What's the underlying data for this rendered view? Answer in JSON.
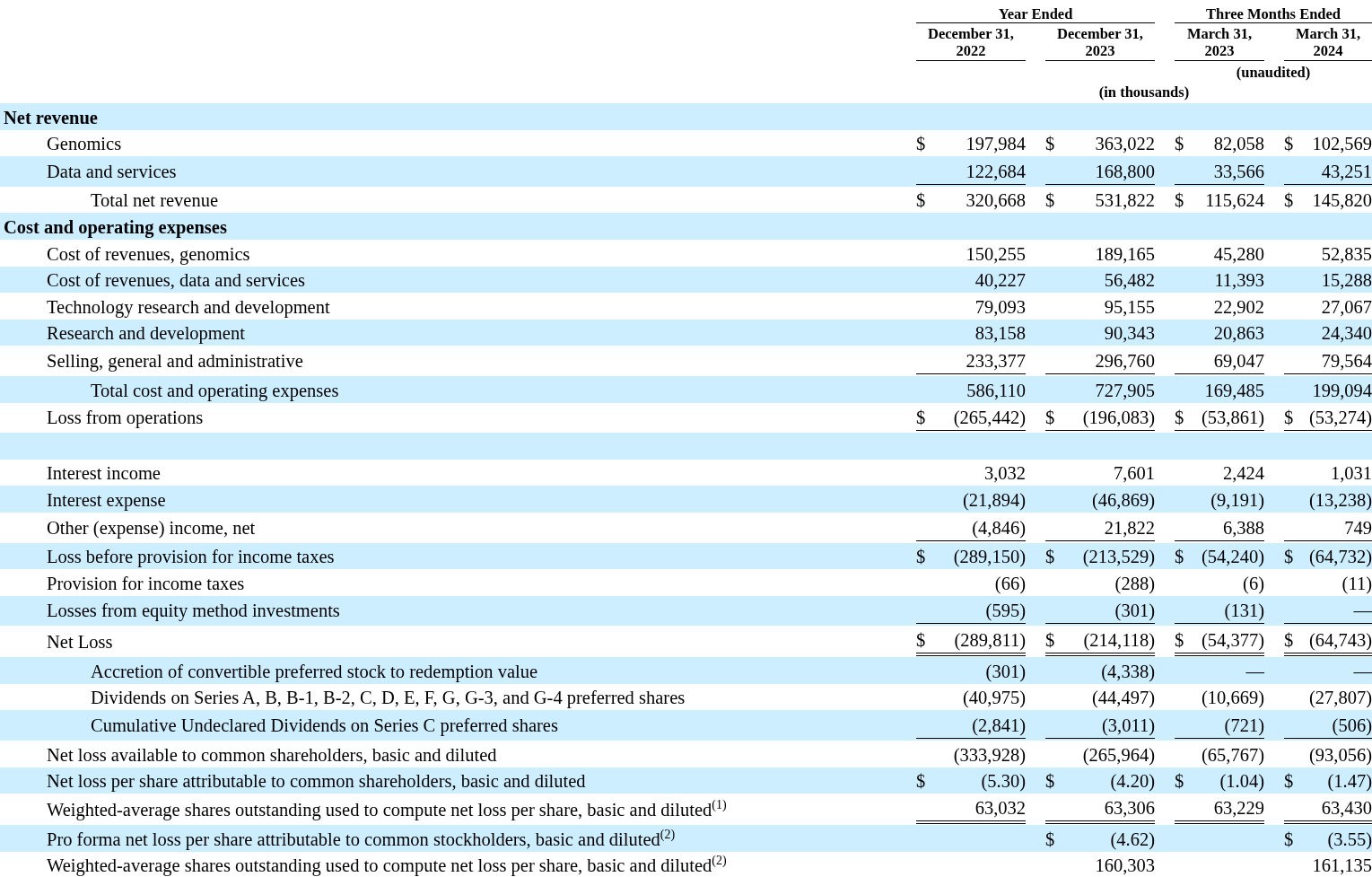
{
  "header": {
    "groups": [
      {
        "label": "Year Ended"
      },
      {
        "label": "Three Months Ended"
      }
    ],
    "columns": [
      "December 31, 2022",
      "December 31, 2023",
      "March 31, 2023",
      "March 31, 2024"
    ],
    "unaudited": "(unaudited)",
    "units": "(in thousands)"
  },
  "rows": [
    {
      "kind": "heading",
      "label": "Net revenue"
    },
    {
      "kind": "line",
      "label": "Genomics",
      "cells": [
        {
          "dollar": "$",
          "value": "197,984"
        },
        {
          "dollar": "$",
          "value": "363,022"
        },
        {
          "dollar": "$",
          "value": "82,058"
        },
        {
          "dollar": "$",
          "value": "102,569"
        }
      ]
    },
    {
      "kind": "line",
      "label": "Data and services",
      "underline": true,
      "cells": [
        {
          "value": "122,684"
        },
        {
          "value": "168,800"
        },
        {
          "value": "33,566"
        },
        {
          "value": "43,251"
        }
      ]
    },
    {
      "kind": "total",
      "label": "Total net revenue",
      "cells": [
        {
          "dollar": "$",
          "value": "320,668"
        },
        {
          "dollar": "$",
          "value": "531,822"
        },
        {
          "dollar": "$",
          "value": "115,624"
        },
        {
          "dollar": "$",
          "value": "145,820"
        }
      ]
    },
    {
      "kind": "heading",
      "label": "Cost and operating expenses"
    },
    {
      "kind": "line",
      "label": "Cost of revenues, genomics",
      "cells": [
        {
          "value": "150,255"
        },
        {
          "value": "189,165"
        },
        {
          "value": "45,280"
        },
        {
          "value": "52,835"
        }
      ]
    },
    {
      "kind": "line",
      "label": "Cost of revenues, data and services",
      "cells": [
        {
          "value": "40,227"
        },
        {
          "value": "56,482"
        },
        {
          "value": "11,393"
        },
        {
          "value": "15,288"
        }
      ]
    },
    {
      "kind": "line",
      "label": "Technology research and development",
      "cells": [
        {
          "value": "79,093"
        },
        {
          "value": "95,155"
        },
        {
          "value": "22,902"
        },
        {
          "value": "27,067"
        }
      ]
    },
    {
      "kind": "line",
      "label": "Research and development",
      "cells": [
        {
          "value": "83,158"
        },
        {
          "value": "90,343"
        },
        {
          "value": "20,863"
        },
        {
          "value": "24,340"
        }
      ]
    },
    {
      "kind": "line",
      "label": "Selling, general and administrative",
      "underline": true,
      "cells": [
        {
          "value": "233,377"
        },
        {
          "value": "296,760"
        },
        {
          "value": "69,047"
        },
        {
          "value": "79,564"
        }
      ]
    },
    {
      "kind": "total",
      "label": "Total cost and operating expenses",
      "cells": [
        {
          "value": "586,110"
        },
        {
          "value": "727,905"
        },
        {
          "value": "169,485"
        },
        {
          "value": "199,094"
        }
      ]
    },
    {
      "kind": "line",
      "label": "Loss from operations",
      "underline": true,
      "cells": [
        {
          "dollar": "$",
          "value": "(265,442)"
        },
        {
          "dollar": "$",
          "value": "(196,083)"
        },
        {
          "dollar": "$",
          "value": "(53,861)"
        },
        {
          "dollar": "$",
          "value": "(53,274)"
        }
      ]
    },
    {
      "kind": "blank"
    },
    {
      "kind": "line",
      "label": "Interest income",
      "cells": [
        {
          "value": "3,032"
        },
        {
          "value": "7,601"
        },
        {
          "value": "2,424"
        },
        {
          "value": "1,031"
        }
      ]
    },
    {
      "kind": "line",
      "label": "Interest expense",
      "cells": [
        {
          "value": "(21,894)"
        },
        {
          "value": "(46,869)"
        },
        {
          "value": "(9,191)"
        },
        {
          "value": "(13,238)"
        }
      ]
    },
    {
      "kind": "line",
      "label": "Other (expense) income, net",
      "underline": true,
      "cells": [
        {
          "value": "(4,846)"
        },
        {
          "value": "21,822"
        },
        {
          "value": "6,388"
        },
        {
          "value": "749"
        }
      ]
    },
    {
      "kind": "line",
      "label": "Loss before provision for income taxes",
      "cells": [
        {
          "dollar": "$",
          "value": "(289,150)"
        },
        {
          "dollar": "$",
          "value": "(213,529)"
        },
        {
          "dollar": "$",
          "value": "(54,240)"
        },
        {
          "dollar": "$",
          "value": "(64,732)"
        }
      ]
    },
    {
      "kind": "line",
      "label": "Provision for income taxes",
      "cells": [
        {
          "value": "(66)"
        },
        {
          "value": "(288)"
        },
        {
          "value": "(6)"
        },
        {
          "value": "(11)"
        }
      ]
    },
    {
      "kind": "line",
      "label": "Losses from equity method investments",
      "underline": true,
      "cells": [
        {
          "value": "(595)"
        },
        {
          "value": "(301)"
        },
        {
          "value": "(131)"
        },
        {
          "value": "—"
        }
      ]
    },
    {
      "kind": "line",
      "label": "Net Loss",
      "double_underline": true,
      "cells": [
        {
          "dollar": "$",
          "value": "(289,811)"
        },
        {
          "dollar": "$",
          "value": "(214,118)"
        },
        {
          "dollar": "$",
          "value": "(54,377)"
        },
        {
          "dollar": "$",
          "value": "(64,743)"
        }
      ]
    },
    {
      "kind": "sub",
      "label": "Accretion of convertible preferred stock to redemption value",
      "cells": [
        {
          "value": "(301)"
        },
        {
          "value": "(4,338)"
        },
        {
          "value": "—"
        },
        {
          "value": "—"
        }
      ]
    },
    {
      "kind": "sub",
      "label": "Dividends on Series A, B, B-1, B-2, C, D, E, F, G, G-3, and G-4 preferred shares",
      "cells": [
        {
          "value": "(40,975)"
        },
        {
          "value": "(44,497)"
        },
        {
          "value": "(10,669)"
        },
        {
          "value": "(27,807)"
        }
      ]
    },
    {
      "kind": "sub",
      "label": "Cumulative Undeclared Dividends on Series C preferred shares",
      "underline": true,
      "cells": [
        {
          "value": "(2,841)"
        },
        {
          "value": "(3,011)"
        },
        {
          "value": "(721)"
        },
        {
          "value": "(506)"
        }
      ]
    },
    {
      "kind": "line",
      "label": "Net loss available to common shareholders, basic and diluted",
      "cells": [
        {
          "value": "(333,928)"
        },
        {
          "value": "(265,964)"
        },
        {
          "value": "(65,767)"
        },
        {
          "value": "(93,056)"
        }
      ]
    },
    {
      "kind": "line",
      "label": "Net loss per share attributable to common shareholders, basic and diluted",
      "cells": [
        {
          "dollar": "$",
          "value": "(5.30)"
        },
        {
          "dollar": "$",
          "value": "(4.20)"
        },
        {
          "dollar": "$",
          "value": "(1.04)"
        },
        {
          "dollar": "$",
          "value": "(1.47)"
        }
      ]
    },
    {
      "kind": "line",
      "label": "Weighted-average shares outstanding used to compute net loss per share, basic and diluted$^{(1)}$",
      "double_underline": true,
      "cells": [
        {
          "value": "63,032"
        },
        {
          "value": "63,306"
        },
        {
          "value": "63,229"
        },
        {
          "value": "63,430"
        }
      ]
    },
    {
      "kind": "line",
      "label": "Pro forma net loss per share attributable to common stockholders, basic and diluted$^{(2)}$",
      "cells": [
        null,
        {
          "dollar": "$",
          "value": "(4.62)"
        },
        null,
        {
          "dollar": "$",
          "value": "(3.55)"
        }
      ]
    },
    {
      "kind": "line",
      "label": "Weighted-average shares outstanding used to compute net loss per share, basic and diluted$^{(2)}$",
      "cells": [
        null,
        {
          "value": "160,303"
        },
        null,
        {
          "value": "161,135"
        }
      ]
    }
  ]
}
